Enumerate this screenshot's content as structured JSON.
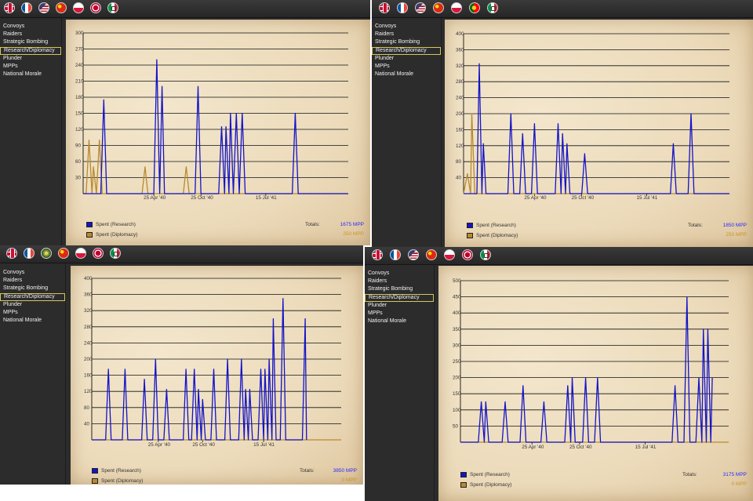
{
  "colors": {
    "research": "#1414c8",
    "diplomacy": "#b88a30",
    "research_total": "#2a2aff",
    "diplomacy_total": "#c8962a",
    "grid": "#111111"
  },
  "menu": [
    "Convoys",
    "Raiders",
    "Strategic Bombing",
    "Research/Diplomacy",
    "Plunder",
    "MPPs",
    "National Morale"
  ],
  "menu_active_index": 3,
  "legend": {
    "research": "Spent (Research)",
    "diplomacy": "Spent (Diplomacy)",
    "totals_label": "Totals:"
  },
  "panels": [
    {
      "flags": [
        "uk",
        "fr",
        "us",
        "cn",
        "pl",
        "ja",
        "it"
      ],
      "flag_icons": [
        "uk-flag-icon",
        "france-flag-icon",
        "usa-flag-icon",
        "china-flag-icon",
        "poland-flag-icon",
        "japan-flag-icon",
        "italy-flag-icon"
      ],
      "research_total": "1675 MPP",
      "diplomacy_total": "250 MPP",
      "chart_data": {
        "type": "line",
        "y_ticks": [
          "300",
          "270",
          "240",
          "210",
          "180",
          "150",
          "120",
          "90",
          "60",
          "30"
        ],
        "ylim": [
          0,
          300
        ],
        "x_tick_labels": [
          "25 Apr '40",
          "25 Oct '40",
          "15 Jul '41"
        ],
        "x_tick_positions": [
          24,
          40,
          62
        ],
        "xlim": [
          0,
          90
        ],
        "series": [
          {
            "name": "Spent (Research)",
            "points": [
              [
                0,
                0
              ],
              [
                6,
                0
              ],
              [
                7,
                175
              ],
              [
                8,
                0
              ],
              [
                24,
                0
              ],
              [
                25,
                250
              ],
              [
                26,
                0
              ],
              [
                26.8,
                200
              ],
              [
                27.6,
                0
              ],
              [
                38,
                0
              ],
              [
                39,
                200
              ],
              [
                40,
                0
              ],
              [
                46,
                0
              ],
              [
                47,
                125
              ],
              [
                48,
                0
              ],
              [
                48.5,
                125
              ],
              [
                49.5,
                0
              ],
              [
                50,
                150
              ],
              [
                51,
                0
              ],
              [
                52,
                150
              ],
              [
                53,
                0
              ],
              [
                54,
                150
              ],
              [
                55,
                0
              ],
              [
                71,
                0
              ],
              [
                72,
                150
              ],
              [
                73,
                0
              ],
              [
                90,
                0
              ]
            ]
          },
          {
            "name": "Spent (Diplomacy)",
            "points": [
              [
                0,
                0
              ],
              [
                1,
                0
              ],
              [
                2,
                100
              ],
              [
                3,
                0
              ],
              [
                3.5,
                50
              ],
              [
                4.5,
                0
              ],
              [
                5.5,
                100
              ],
              [
                6.5,
                0
              ],
              [
                20,
                0
              ],
              [
                21,
                50
              ],
              [
                22,
                0
              ],
              [
                34,
                0
              ],
              [
                35,
                50
              ],
              [
                36,
                0
              ],
              [
                90,
                0
              ]
            ]
          }
        ]
      }
    },
    {
      "flags": [
        "uk",
        "fr",
        "us",
        "cn",
        "pl",
        "pt",
        "it"
      ],
      "flag_icons": [
        "uk-flag-icon",
        "france-flag-icon",
        "usa-flag-icon",
        "china-flag-icon",
        "poland-flag-icon",
        "portugal-flag-icon",
        "italy-flag-icon"
      ],
      "research_total": "1850 MPP",
      "diplomacy_total": "250 MPP",
      "chart_data": {
        "type": "line",
        "y_ticks": [
          "400",
          "360",
          "320",
          "280",
          "240",
          "200",
          "160",
          "120",
          "80",
          "40"
        ],
        "ylim": [
          0,
          400
        ],
        "x_tick_labels": [
          "25 Apr '40",
          "25 Oct '40",
          "15 Jul '41"
        ],
        "x_tick_positions": [
          24,
          40,
          62
        ],
        "xlim": [
          0,
          90
        ],
        "series": [
          {
            "name": "Spent (Research)",
            "points": [
              [
                0,
                0
              ],
              [
                1,
                0
              ],
              [
                2,
                0
              ],
              [
                4.5,
                0
              ],
              [
                5.3,
                325
              ],
              [
                6.2,
                0
              ],
              [
                6.7,
                125
              ],
              [
                7.6,
                0
              ],
              [
                15,
                0
              ],
              [
                16,
                200
              ],
              [
                17,
                0
              ],
              [
                19,
                0
              ],
              [
                20,
                150
              ],
              [
                21,
                0
              ],
              [
                23,
                0
              ],
              [
                24,
                175
              ],
              [
                25,
                0
              ],
              [
                31,
                0
              ],
              [
                32,
                175
              ],
              [
                33,
                0
              ],
              [
                33.5,
                150
              ],
              [
                34.5,
                0
              ],
              [
                35,
                125
              ],
              [
                36,
                0
              ],
              [
                40,
                0
              ],
              [
                41,
                100
              ],
              [
                42,
                0
              ],
              [
                70,
                0
              ],
              [
                71,
                125
              ],
              [
                72,
                0
              ],
              [
                76,
                0
              ],
              [
                77,
                200
              ],
              [
                78,
                0
              ],
              [
                90,
                0
              ]
            ]
          },
          {
            "name": "Spent (Diplomacy)",
            "points": [
              [
                0,
                0
              ],
              [
                1.3,
                50
              ],
              [
                2.4,
                0
              ],
              [
                2.8,
                200
              ],
              [
                3.8,
                0
              ],
              [
                90,
                0
              ]
            ]
          }
        ]
      }
    },
    {
      "flags": [
        "uk",
        "fr",
        "gr",
        "cn",
        "pl",
        "ja",
        "it"
      ],
      "flag_icons": [
        "uk-flag-icon",
        "france-flag-icon",
        "germany-flag-icon",
        "china-flag-icon",
        "poland-flag-icon",
        "japan-flag-icon",
        "italy-flag-icon"
      ],
      "research_total": "3850 MPP",
      "diplomacy_total": "0 MPP",
      "chart_data": {
        "type": "line",
        "y_ticks": [
          "400",
          "360",
          "320",
          "280",
          "240",
          "200",
          "160",
          "120",
          "80",
          "40"
        ],
        "ylim": [
          0,
          400
        ],
        "x_tick_labels": [
          "25 Apr '40",
          "25 Oct '40",
          "15 Jul '41"
        ],
        "x_tick_positions": [
          24,
          40,
          62
        ],
        "xlim": [
          0,
          90
        ],
        "series": [
          {
            "name": "Spent (Research)",
            "points": [
              [
                0,
                0
              ],
              [
                5,
                0
              ],
              [
                6,
                175
              ],
              [
                7,
                0
              ],
              [
                11,
                0
              ],
              [
                12,
                175
              ],
              [
                13,
                0
              ],
              [
                18,
                0
              ],
              [
                19,
                150
              ],
              [
                20,
                0
              ],
              [
                22,
                0
              ],
              [
                23,
                200
              ],
              [
                24,
                0
              ],
              [
                26,
                0
              ],
              [
                27,
                125
              ],
              [
                28,
                0
              ],
              [
                33,
                0
              ],
              [
                34,
                175
              ],
              [
                35,
                0
              ],
              [
                36,
                0
              ],
              [
                37,
                175
              ],
              [
                38,
                0
              ],
              [
                38.5,
                125
              ],
              [
                39.5,
                0
              ],
              [
                40,
                100
              ],
              [
                41,
                0
              ],
              [
                43,
                0
              ],
              [
                44,
                175
              ],
              [
                45,
                0
              ],
              [
                48,
                0
              ],
              [
                49,
                200
              ],
              [
                50,
                0
              ],
              [
                53,
                0
              ],
              [
                54,
                200
              ],
              [
                55,
                0
              ],
              [
                55.5,
                125
              ],
              [
                56.5,
                0
              ],
              [
                57,
                125
              ],
              [
                58,
                0
              ],
              [
                60,
                0
              ],
              [
                61,
                175
              ],
              [
                62,
                0
              ],
              [
                62.5,
                175
              ],
              [
                63.5,
                0
              ],
              [
                64,
                200
              ],
              [
                65,
                0
              ],
              [
                65.5,
                300
              ],
              [
                66.5,
                0
              ],
              [
                68,
                0
              ],
              [
                69,
                350
              ],
              [
                70,
                0
              ],
              [
                76,
                0
              ],
              [
                77,
                300
              ],
              [
                77.5,
                0
              ]
            ]
          },
          {
            "name": "Spent (Diplomacy)",
            "points": [
              [
                0,
                0
              ],
              [
                90,
                0
              ]
            ]
          }
        ]
      }
    },
    {
      "flags": [
        "uk",
        "fr",
        "us",
        "cn",
        "pl",
        "ja",
        "it"
      ],
      "flag_icons": [
        "uk-flag-icon",
        "france-flag-icon",
        "usa-flag-icon",
        "china-flag-icon",
        "poland-flag-icon",
        "japan-flag-icon",
        "italy-flag-icon"
      ],
      "research_total": "3175 MPP",
      "diplomacy_total": "0 MPP",
      "chart_data": {
        "type": "line",
        "y_ticks": [
          "500",
          "450",
          "400",
          "350",
          "300",
          "250",
          "200",
          "150",
          "100",
          "50"
        ],
        "ylim": [
          0,
          500
        ],
        "x_tick_labels": [
          "25 Apr '40",
          "25 Oct '40",
          "15 Jul '41"
        ],
        "x_tick_positions": [
          24,
          40,
          62
        ],
        "xlim": [
          0,
          90
        ],
        "series": [
          {
            "name": "Spent (Research)",
            "points": [
              [
                0,
                0
              ],
              [
                6,
                0
              ],
              [
                7,
                125
              ],
              [
                8,
                0
              ],
              [
                8.5,
                125
              ],
              [
                9.5,
                0
              ],
              [
                14,
                0
              ],
              [
                15,
                125
              ],
              [
                16,
                0
              ],
              [
                20,
                0
              ],
              [
                21,
                175
              ],
              [
                22,
                0
              ],
              [
                27,
                0
              ],
              [
                28,
                125
              ],
              [
                29,
                0
              ],
              [
                35,
                0
              ],
              [
                36,
                175
              ],
              [
                37,
                0
              ],
              [
                37.5,
                200
              ],
              [
                38.5,
                0
              ],
              [
                41,
                0
              ],
              [
                42,
                200
              ],
              [
                43,
                0
              ],
              [
                45,
                0
              ],
              [
                46,
                200
              ],
              [
                47,
                0
              ],
              [
                71,
                0
              ],
              [
                72,
                175
              ],
              [
                73,
                0
              ],
              [
                75,
                0
              ],
              [
                76,
                450
              ],
              [
                77,
                0
              ],
              [
                79,
                0
              ],
              [
                80,
                200
              ],
              [
                81,
                0
              ],
              [
                81.5,
                350
              ],
              [
                82.5,
                0
              ],
              [
                83,
                350
              ],
              [
                84,
                0
              ],
              [
                84.5,
                200
              ]
            ]
          },
          {
            "name": "Spent (Diplomacy)",
            "points": [
              [
                0,
                0
              ],
              [
                90,
                0
              ]
            ]
          }
        ]
      }
    }
  ]
}
